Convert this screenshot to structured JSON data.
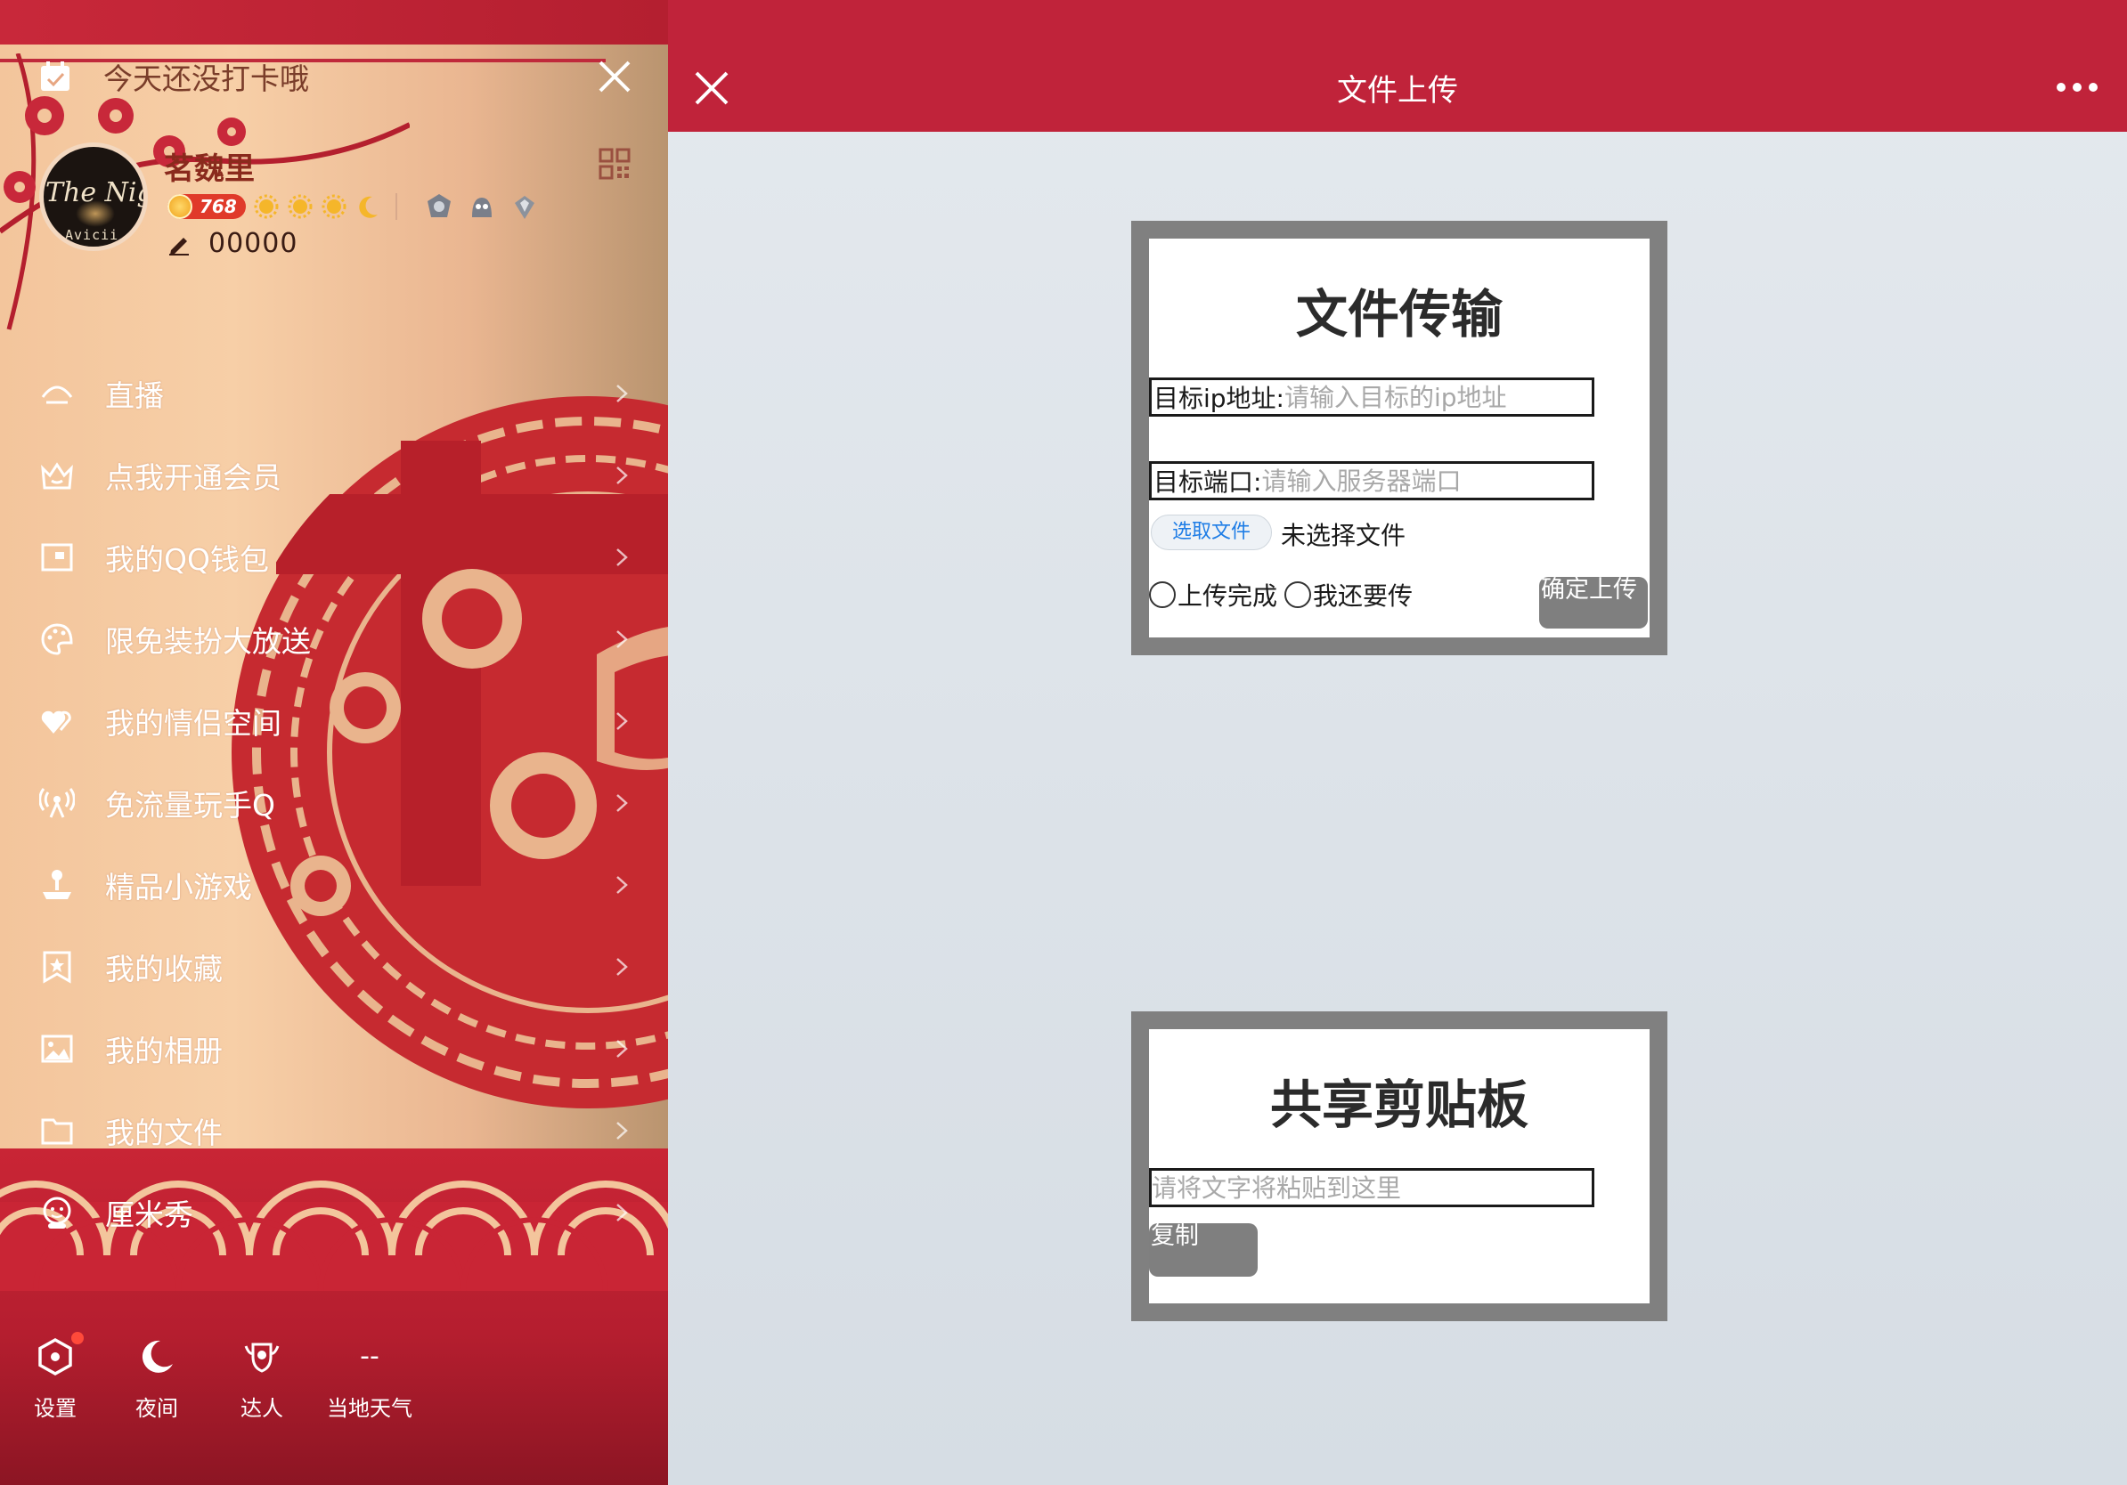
{
  "drawer": {
    "checkin_text": "今天还没打卡哦",
    "user": {
      "name": "茗魏里",
      "avatar_text_line1": "The Nigh",
      "avatar_text_line2": "Avicii",
      "level_number": "768",
      "signature": "00000"
    },
    "menu": [
      {
        "label": "直播",
        "icon": "live-icon"
      },
      {
        "label": "点我开通会员",
        "icon": "crown-icon"
      },
      {
        "label": "我的QQ钱包",
        "icon": "wallet-icon"
      },
      {
        "label": "限免装扮大放送",
        "icon": "palette-icon"
      },
      {
        "label": "我的情侣空间",
        "icon": "hearts-icon"
      },
      {
        "label": "免流量玩手Q",
        "icon": "signal-icon"
      },
      {
        "label": "精品小游戏",
        "icon": "joystick-icon"
      },
      {
        "label": "我的收藏",
        "icon": "bookmark-star-icon"
      },
      {
        "label": "我的相册",
        "icon": "photo-icon"
      },
      {
        "label": "我的文件",
        "icon": "folder-icon"
      },
      {
        "label": "厘米秀",
        "icon": "avatar-face-icon"
      }
    ],
    "bottom": [
      {
        "label": "设置",
        "icon": "settings-hex-icon"
      },
      {
        "label": "夜间",
        "icon": "moon-icon"
      },
      {
        "label": "达人",
        "icon": "expert-badge-icon"
      },
      {
        "label": "当地天气",
        "icon": "weather-dash-icon",
        "value": "--"
      }
    ]
  },
  "main": {
    "title": "文件上传",
    "upload": {
      "heading": "文件传输",
      "ip_label": "目标ip地址:",
      "ip_placeholder": "请输入目标的ip地址",
      "port_label": "目标端口:",
      "port_placeholder": "请输入服务器端口",
      "choose_file": "选取文件",
      "no_file": "未选择文件",
      "radio_done": "上传完成",
      "radio_more": "我还要传",
      "submit": "确定上传"
    },
    "clipboard": {
      "heading": "共享剪贴板",
      "placeholder": "请将文字将粘贴到这里",
      "copy": "复制"
    }
  },
  "colors": {
    "nav_red": "#c0233a",
    "panel_border": "#808080",
    "drawer_peach": "#f3c59c",
    "link_blue": "#1e7de6"
  }
}
